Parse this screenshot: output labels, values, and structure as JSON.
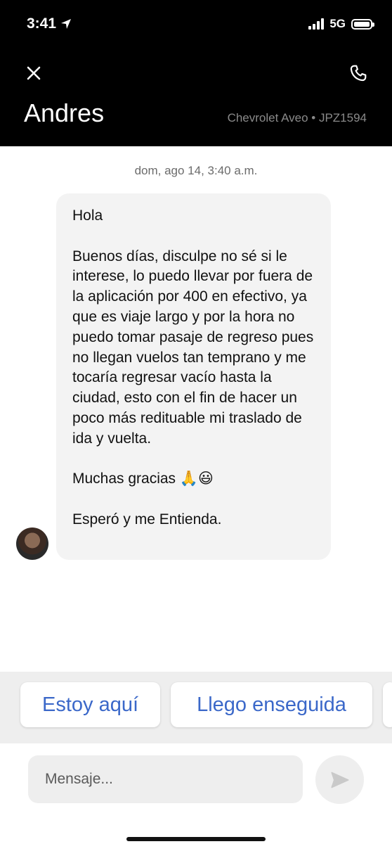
{
  "status_bar": {
    "time": "3:41",
    "network": "5G"
  },
  "header": {
    "contact_name": "Andres",
    "vehicle": "Chevrolet Aveo • JPZ1594"
  },
  "chat": {
    "timestamp": "dom, ago 14, 3:40 a.m.",
    "message": {
      "paragraphs": [
        "Hola",
        "Buenos días, disculpe no sé si le interese, lo puedo llevar por fuera de la aplicación por 400 en efectivo, ya que es viaje largo y por la hora no puedo tomar pasaje de regreso pues no llegan vuelos tan temprano y me tocaría regresar vacío hasta la ciudad, esto con el fin de hacer un poco más redituable mi traslado de ida y vuelta.",
        "Muchas gracias 🙏😃",
        "Esperó y me Entienda."
      ]
    }
  },
  "quick_replies": [
    "Estoy aquí",
    "Llego enseguida"
  ],
  "composer": {
    "placeholder": "Mensaje..."
  },
  "icons": {
    "close": "close-icon",
    "phone": "phone-icon",
    "send": "send-icon",
    "location": "location-arrow-icon"
  }
}
